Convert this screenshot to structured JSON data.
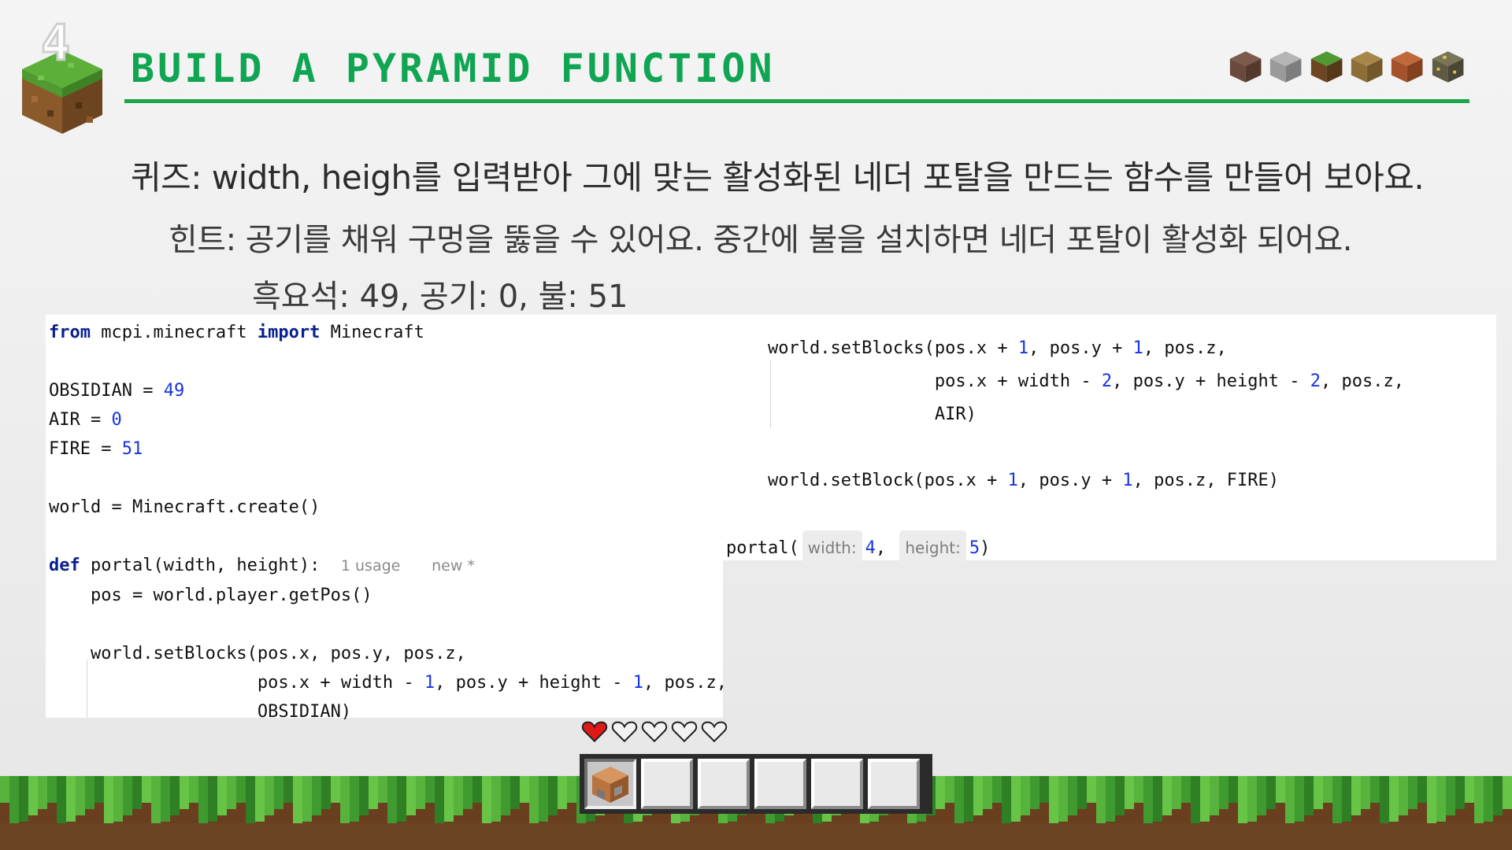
{
  "slide": {
    "number": "4",
    "title": "BUILD A PYRAMID FUNCTION",
    "accent_color": "#1aa64b",
    "title_color": "#0fa552",
    "block_icons": [
      "dirt-block-icon",
      "stone-block-icon",
      "grass-block-icon",
      "planks-block-icon",
      "brick-block-icon",
      "ore-block-icon"
    ]
  },
  "quiz": "퀴즈: width, heigh를 입력받아 그에 맞는 활성화된 네더 포탈을 만드는 함수를 만들어 보아요.",
  "hint": "힌트: 공기를 채워 구멍을 뚫을 수 있어요. 중간에 불을 설치하면 네더 포탈이 활성화 되어요.",
  "values_line": "흑요석: 49, 공기: 0, 불: 51",
  "code_left": {
    "l1_from": "from",
    "l1_mod": " mcpi.minecraft ",
    "l1_import": "import",
    "l1_name": " Minecraft",
    "l3_name": "OBSIDIAN = ",
    "l3_val": "49",
    "l4_name": "AIR = ",
    "l4_val": "0",
    "l5_name": "FIRE = ",
    "l5_val": "51",
    "l7": "world = Minecraft.create()",
    "l9_def": "def",
    "l9_sig": " portal(width, height):",
    "l9_usage": "1 usage",
    "l9_new": "new *",
    "l10": "    pos = world.player.getPos()",
    "l12": "    world.setBlocks(pos.x, pos.y, pos.z,",
    "l13_a": "                    pos.x + width - ",
    "l13_n1": "1",
    "l13_b": ", pos.y + height - ",
    "l13_n2": "1",
    "l13_c": ", pos.z,",
    "l14": "                    OBSIDIAN)"
  },
  "code_right": {
    "r1_a": "    world.setBlocks(pos.x + ",
    "r1_n1": "1",
    "r1_b": ", pos.y + ",
    "r1_n2": "1",
    "r1_c": ", pos.z,",
    "r2_a": "                    pos.x + width - ",
    "r2_n1": "2",
    "r2_b": ", pos.y + height - ",
    "r2_n2": "2",
    "r2_c": ", pos.z,",
    "r3": "                    AIR)",
    "r5_a": "    world.setBlock(pos.x + ",
    "r5_n1": "1",
    "r5_b": ", pos.y + ",
    "r5_n2": "1",
    "r5_c": ", pos.z, FIRE)",
    "call_fn": "portal(",
    "call_p1_label": "width:",
    "call_p1_val": "4",
    "call_sep": ",",
    "call_p2_label": "height:",
    "call_p2_val": "5",
    "call_end": ")"
  },
  "hud": {
    "hearts": [
      "full",
      "empty",
      "empty",
      "empty",
      "empty"
    ],
    "hotbar_slots": [
      "command-block",
      "empty",
      "empty",
      "empty",
      "empty",
      "empty"
    ]
  }
}
